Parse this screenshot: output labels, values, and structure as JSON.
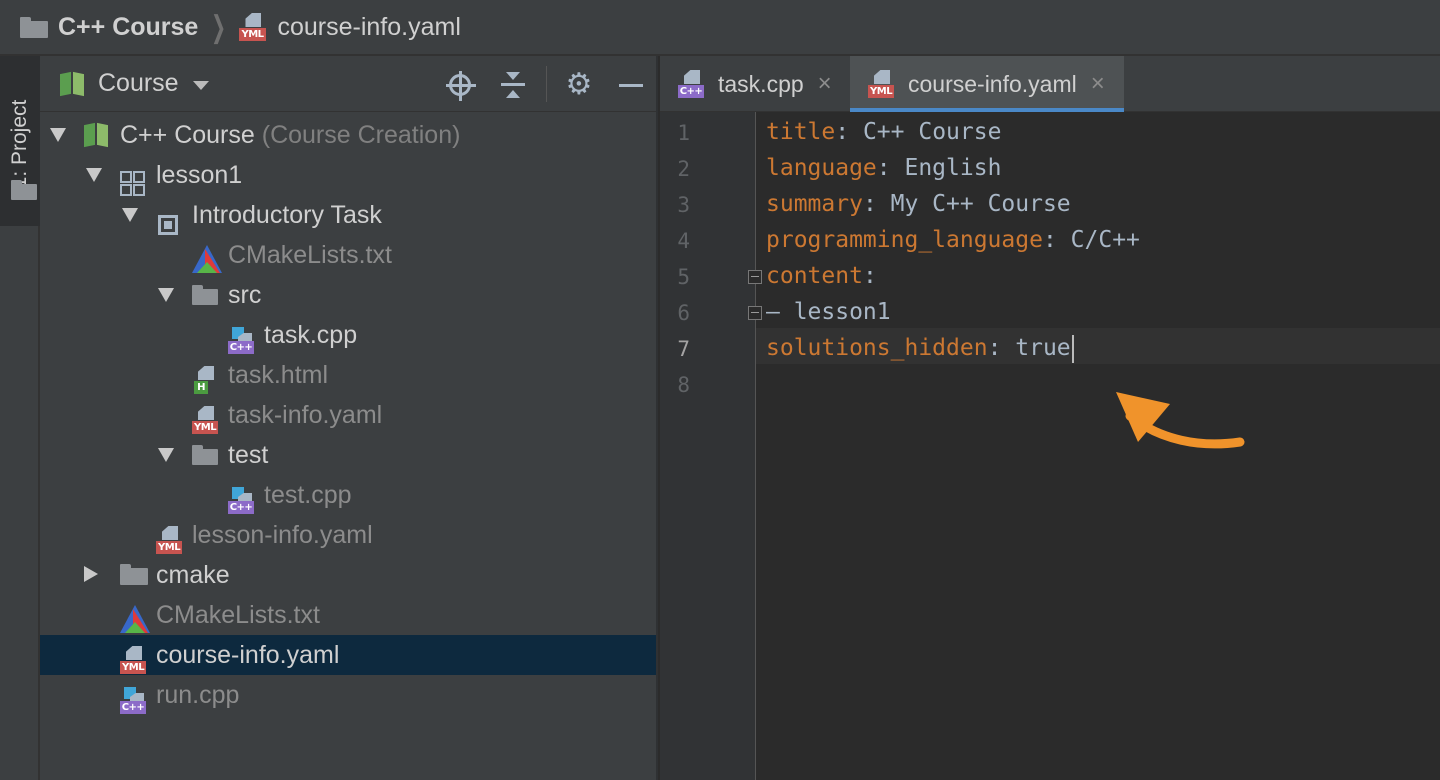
{
  "breadcrumb": {
    "project": "C++ Course",
    "file": "course-info.yaml",
    "file_badge": "YML"
  },
  "tool_stripe": {
    "project_tab": "1: Project"
  },
  "project_panel": {
    "view_selector": "Course",
    "tree": [
      {
        "label": "C++ Course",
        "hint": "(Course Creation)",
        "type": "course",
        "expanded": true,
        "dim": false
      },
      {
        "label": "lesson1",
        "type": "lesson",
        "expanded": true,
        "dim": false
      },
      {
        "label": "Introductory Task",
        "type": "task",
        "expanded": true,
        "dim": false
      },
      {
        "label": "CMakeLists.txt",
        "type": "cmake",
        "dim": true
      },
      {
        "label": "src",
        "type": "folder",
        "expanded": true,
        "dim": false
      },
      {
        "label": "task.cpp",
        "type": "cpp",
        "dim": false
      },
      {
        "label": "task.html",
        "type": "html",
        "dim": true
      },
      {
        "label": "task-info.yaml",
        "type": "yaml",
        "dim": true
      },
      {
        "label": "test",
        "type": "folder",
        "expanded": true,
        "dim": false
      },
      {
        "label": "test.cpp",
        "type": "cpp",
        "dim": true
      },
      {
        "label": "lesson-info.yaml",
        "type": "yaml",
        "dim": true
      },
      {
        "label": "cmake",
        "type": "folder",
        "expanded": false,
        "dim": false
      },
      {
        "label": "CMakeLists.txt",
        "type": "cmake",
        "dim": true
      },
      {
        "label": "course-info.yaml",
        "type": "yaml",
        "selected": true,
        "dim": false
      },
      {
        "label": "run.cpp",
        "type": "cpp",
        "dim": true
      }
    ],
    "badges": {
      "yml": "YML",
      "cpp": "C++",
      "html": "H"
    }
  },
  "editor": {
    "tabs": [
      {
        "label": "task.cpp",
        "badge": "C++",
        "active": false
      },
      {
        "label": "course-info.yaml",
        "badge": "YML",
        "active": true
      }
    ],
    "close_glyph": "×",
    "current_line": 7,
    "line_numbers": [
      "1",
      "2",
      "3",
      "4",
      "5",
      "6",
      "7",
      "8"
    ],
    "lines": [
      {
        "key": "title",
        "sep": ": ",
        "value": "C++ Course"
      },
      {
        "key": "language",
        "sep": ": ",
        "value": "English"
      },
      {
        "key": "summary",
        "sep": ": ",
        "value": "My C++ Course"
      },
      {
        "key": "programming_language",
        "sep": ": ",
        "value": "C/C++"
      },
      {
        "key": "content",
        "sep": ":",
        "value": ""
      },
      {
        "key": "",
        "sep": "",
        "value": "– lesson1"
      },
      {
        "key": "solutions_hidden",
        "sep": ": ",
        "value": "true"
      },
      {
        "key": "",
        "sep": "",
        "value": ""
      }
    ]
  },
  "colors": {
    "annotation_arrow": "#f0932b",
    "yaml_key": "#cc7832",
    "selection": "#0d293e",
    "tab_underline": "#4a88c7"
  },
  "icons": {
    "navbar_folder": "folder-icon",
    "locate": "crosshair-icon",
    "collapse_all": "collapse-all-icon",
    "settings": "gear-icon",
    "hide": "minimize-icon"
  }
}
